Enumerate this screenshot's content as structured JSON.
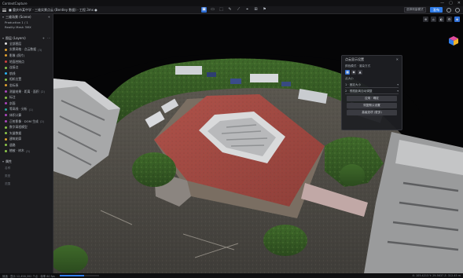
{
  "window": {
    "title": "ContextCapture",
    "controls": [
      "—",
      "▢",
      "✕"
    ]
  },
  "toolbar": {
    "project_path": "■ 重庆市某中学 - 三维实景点云 (Bentley 数据) - 工程.3mx   ●",
    "mode_select": "选择测量模式",
    "publish_label": "发布",
    "tools": [
      "▣",
      "▭",
      "⬚",
      "✎",
      "⟋",
      "⌖",
      "⊞",
      "⚑"
    ]
  },
  "left_panel": {
    "scene_header": "三维场景 (Scene)",
    "scene_items": [
      {
        "key": "Production",
        "value": "1 / 1"
      },
      {
        "key": "Reality Mesh",
        "value": "3MX"
      }
    ],
    "layers_header": "图层 (Layers)",
    "layers": [
      {
        "label": "全部图层",
        "value": "",
        "color": "#e0e0e0"
      },
      {
        "label": "实景网格 · 点云数据",
        "value": "(3)",
        "color": "#e0a030"
      },
      {
        "label": "影像 (照片)",
        "value": "",
        "color": "#e0a030"
      },
      {
        "label": "地面控制点",
        "value": "",
        "color": "#d04040"
      },
      {
        "label": "连接点",
        "value": "",
        "color": "#8bc34a"
      },
      {
        "label": "航线",
        "value": "",
        "color": "#29b6f6"
      },
      {
        "label": "相机位置",
        "value": "",
        "color": "#8bc34a"
      },
      {
        "label": "坐标系",
        "value": "",
        "color": "#e0a030"
      },
      {
        "label": "测量结果 · 距离 · 面积",
        "value": "(2)",
        "color": "#ab47bc"
      },
      {
        "label": "标注",
        "value": "",
        "color": "#8bc34a"
      },
      {
        "label": "剖面",
        "value": "",
        "color": "#ab47bc"
      },
      {
        "label": "等高线 · 分析",
        "value": "(1)",
        "color": "#26a69a"
      },
      {
        "label": "体积计算",
        "value": "",
        "color": "#ab47bc"
      },
      {
        "label": "正射影像 · DOM 生成",
        "value": "(2)",
        "color": "#ab47bc"
      },
      {
        "label": "数字高程模型",
        "value": "",
        "color": "#8bc34a"
      },
      {
        "label": "矢量数据",
        "value": "",
        "color": "#8bc34a"
      },
      {
        "label": "建筑轮廓",
        "value": "",
        "color": "#e0a030"
      },
      {
        "label": "道路",
        "value": "",
        "color": "#8bc34a"
      },
      {
        "label": "植被 · 树木",
        "value": "(3)",
        "color": "#8bc34a"
      }
    ],
    "properties_header": "属性",
    "properties_rows": [
      "名称",
      "类型",
      "范围"
    ]
  },
  "viewport": {
    "top_icons": [
      "⊕",
      "⌂",
      "◐",
      "⚙",
      "◆"
    ],
    "navcube_colors": [
      "#e14b9c",
      "#2f7ce8",
      "#f0b429"
    ]
  },
  "float_panel": {
    "title": "点云显示设置",
    "subtitle": "颜色模式 · 渲染方式",
    "swatches": [
      "■",
      "◆",
      "▲"
    ],
    "section_label": "点大小",
    "select_value": "1 · 固定大小",
    "option_value": "2 · 根据距离自动调整",
    "buttons": [
      "应用 · 确定",
      "恢复默认设置",
      "高级选项 (更多)"
    ]
  },
  "statusbar": {
    "left": "就绪 · 显示 12,458,392 个点 · 帧率 60 fps",
    "progress": 0.62,
    "right": "X: 105.4213  Y: 29.5637  Z: 312.45 m"
  }
}
